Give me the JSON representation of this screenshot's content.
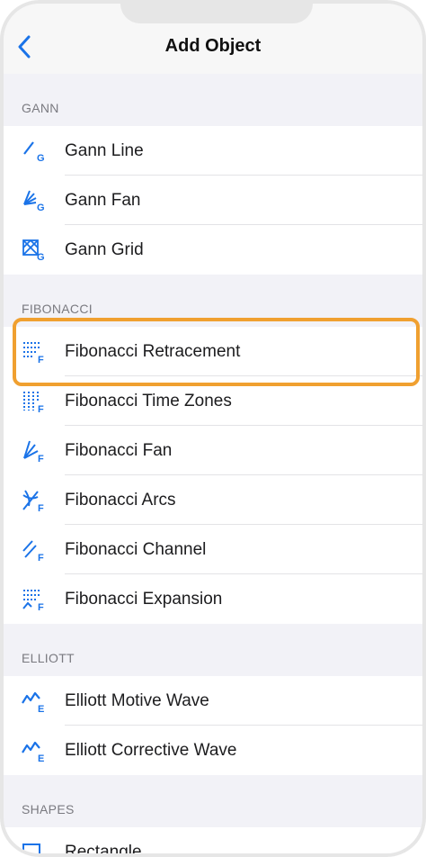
{
  "header": {
    "title": "Add Object"
  },
  "sections": [
    {
      "title": "GANN",
      "items": [
        {
          "label": "Gann Line",
          "icon": "gann-line-icon"
        },
        {
          "label": "Gann Fan",
          "icon": "gann-fan-icon"
        },
        {
          "label": "Gann Grid",
          "icon": "gann-grid-icon"
        }
      ]
    },
    {
      "title": "FIBONACCI",
      "items": [
        {
          "label": "Fibonacci Retracement",
          "icon": "fibonacci-retracement-icon"
        },
        {
          "label": "Fibonacci Time Zones",
          "icon": "fibonacci-time-zones-icon"
        },
        {
          "label": "Fibonacci Fan",
          "icon": "fibonacci-fan-icon"
        },
        {
          "label": "Fibonacci Arcs",
          "icon": "fibonacci-arcs-icon"
        },
        {
          "label": "Fibonacci Channel",
          "icon": "fibonacci-channel-icon"
        },
        {
          "label": "Fibonacci Expansion",
          "icon": "fibonacci-expansion-icon"
        }
      ]
    },
    {
      "title": "ELLIOTT",
      "items": [
        {
          "label": "Elliott Motive Wave",
          "icon": "elliott-motive-wave-icon"
        },
        {
          "label": "Elliott Corrective Wave",
          "icon": "elliott-corrective-wave-icon"
        }
      ]
    },
    {
      "title": "SHAPES",
      "items": [
        {
          "label": "Rectangle",
          "icon": "rectangle-icon"
        }
      ]
    }
  ],
  "colors": {
    "accent": "#1a73e8",
    "highlight": "#f0a030"
  }
}
